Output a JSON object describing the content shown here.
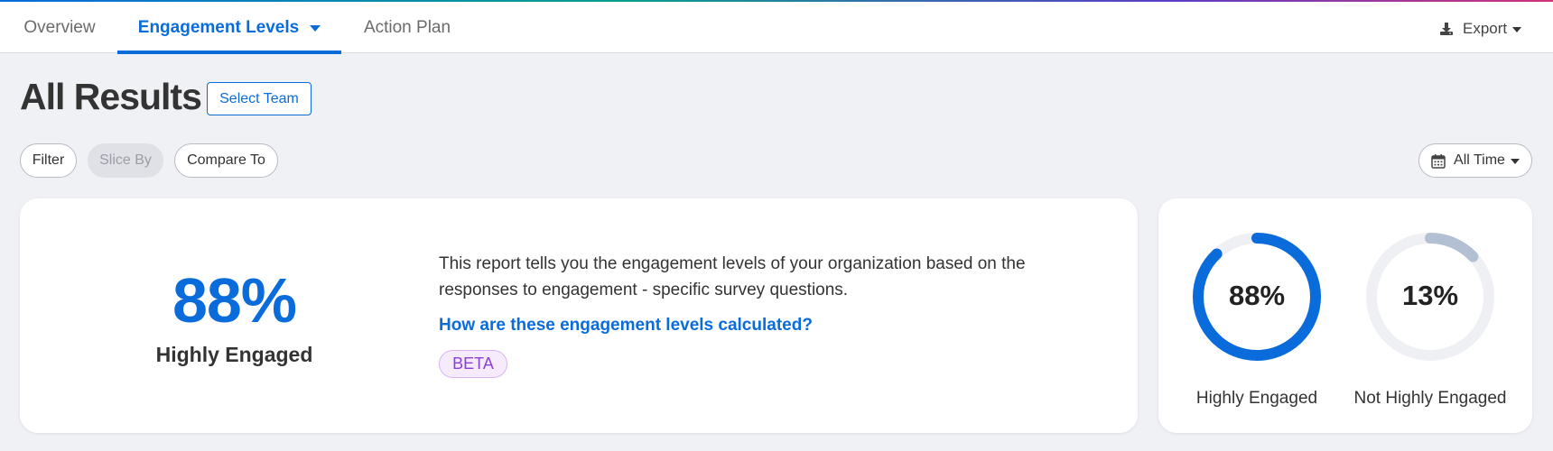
{
  "tabs": [
    {
      "label": "Overview"
    },
    {
      "label": "Engagement Levels"
    },
    {
      "label": "Action Plan"
    }
  ],
  "export_label": "Export",
  "page_title": "All Results",
  "select_team_label": "Select Team",
  "filters": {
    "filter": "Filter",
    "slice_by": "Slice By",
    "compare_to": "Compare To"
  },
  "time_range": "All Time",
  "summary": {
    "percent": "88%",
    "label": "Highly Engaged",
    "description": "This report tells you the engagement levels of your organization based on the responses to engagement - specific survey questions.",
    "link": "How are these engagement levels calculated?",
    "badge": "BETA"
  },
  "donuts": [
    {
      "value": 88,
      "text": "88%",
      "label": "Highly Engaged",
      "color": "#0a6cdb"
    },
    {
      "value": 13,
      "text": "13%",
      "label": "Not Highly Engaged",
      "color": "#b3bfd3"
    }
  ],
  "colors": {
    "accent": "#0a6cdb",
    "background": "#f0f1f5",
    "track": "#eef0f4",
    "beta_text": "#8a3fd4"
  },
  "icons": {
    "export": "download-icon",
    "calendar": "calendar-icon"
  }
}
